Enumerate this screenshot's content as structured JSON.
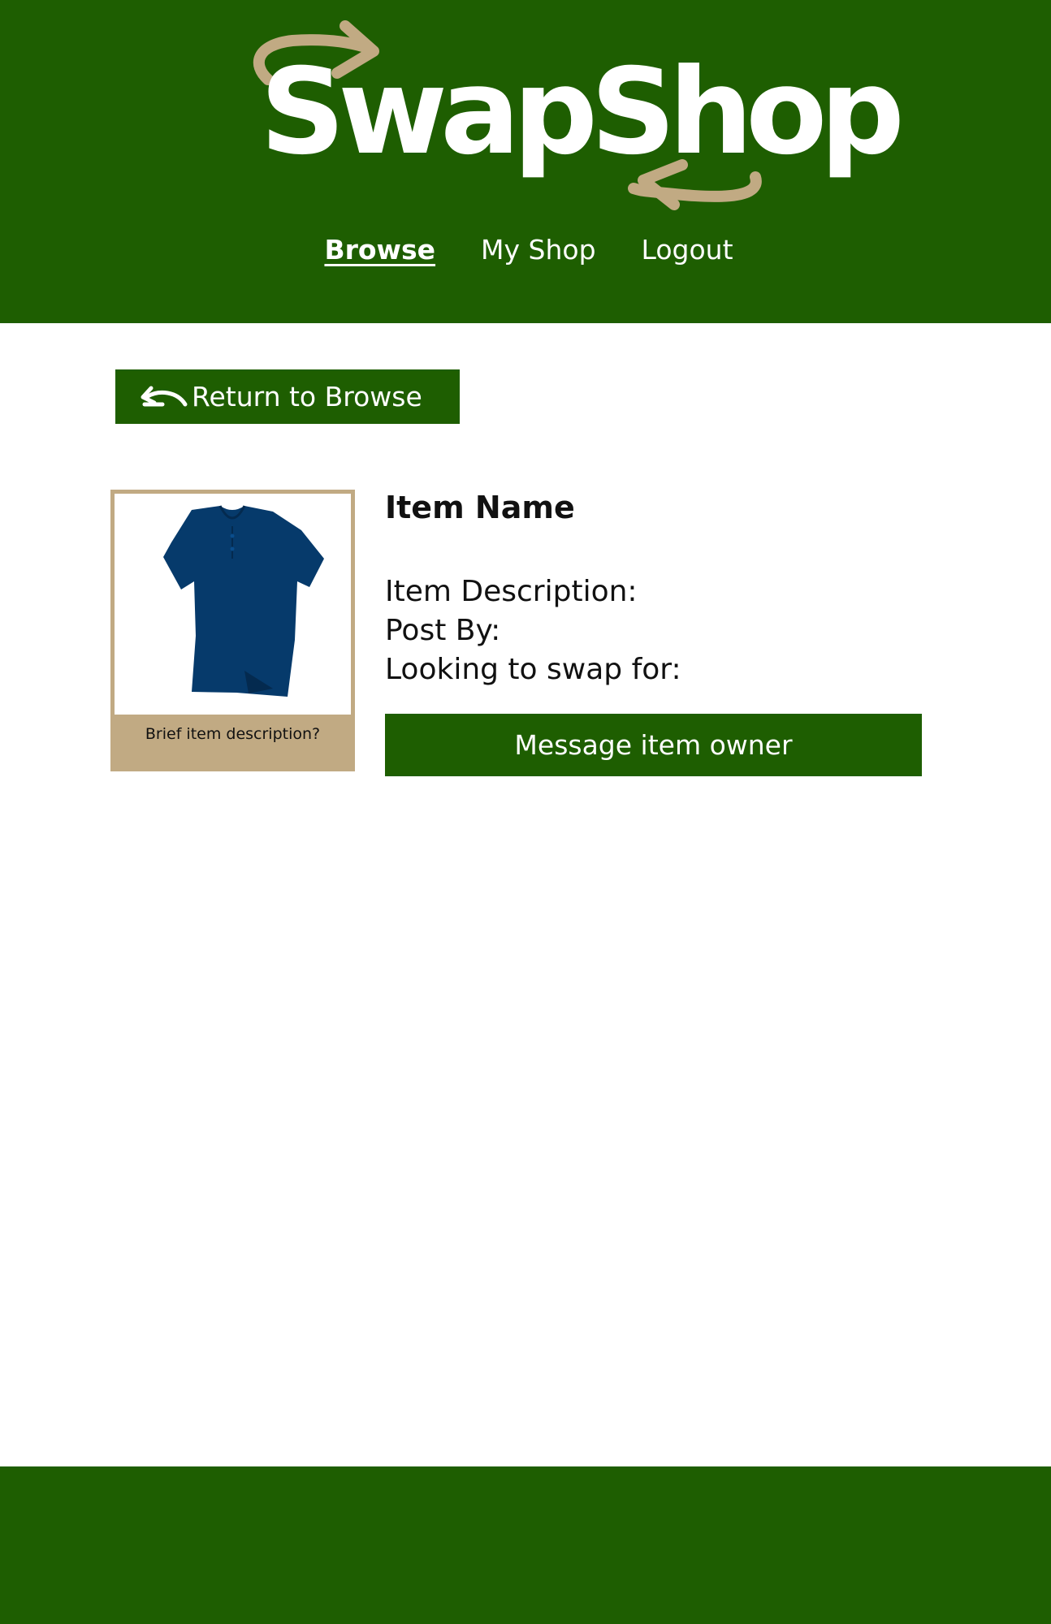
{
  "brand": {
    "name": "SwapShop",
    "colors": {
      "primary": "#1e5e01",
      "accent": "#c1aa83",
      "text_light": "#ffffff"
    }
  },
  "nav": {
    "items": [
      {
        "label": "Browse",
        "active": true
      },
      {
        "label": "My Shop",
        "active": false
      },
      {
        "label": "Logout",
        "active": false
      }
    ]
  },
  "return_button": {
    "label": "Return to Browse",
    "icon": "back-arrow-icon"
  },
  "item_card": {
    "image": "navy-polo-shirt",
    "caption": "Brief item description?"
  },
  "details": {
    "item_name": "Item Name",
    "description_label": "Item Description:",
    "posted_by_label": "Post By:",
    "swap_for_label": "Looking to swap for:"
  },
  "message_button": {
    "label": "Message item owner"
  }
}
